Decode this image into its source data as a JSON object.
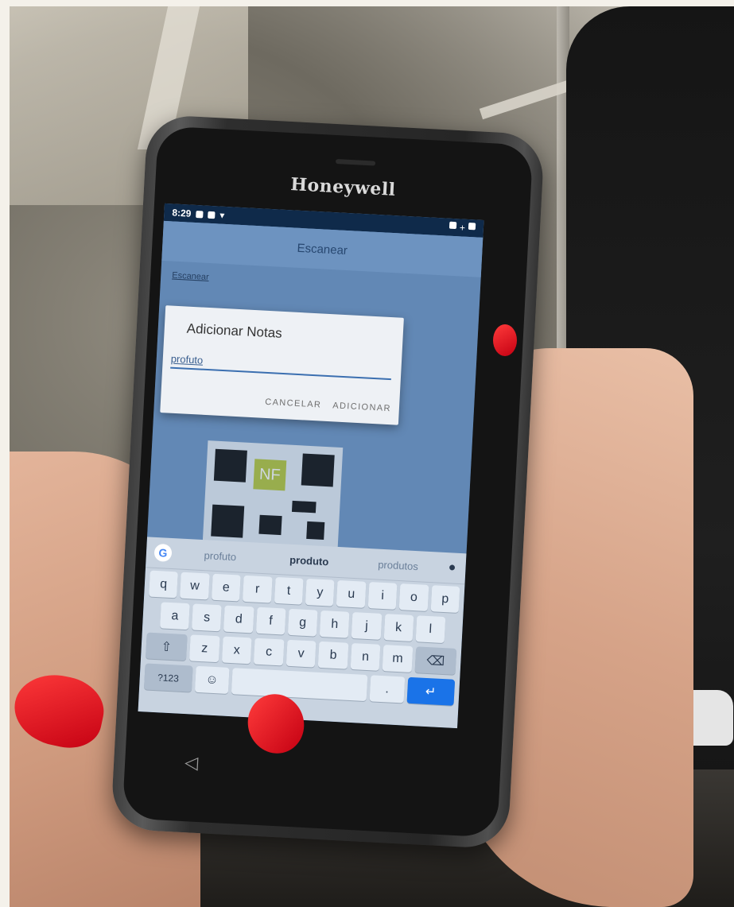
{
  "device": {
    "brand": "Honeywell"
  },
  "status_bar": {
    "time": "8:29"
  },
  "app": {
    "title": "Escanear",
    "content_label": "Escanear"
  },
  "dialog": {
    "title": "Adicionar Notas",
    "input_value": "profuto",
    "cancel_label": "CANCELAR",
    "confirm_label": "ADICIONAR"
  },
  "qr": {
    "overlay_text": "NF"
  },
  "keyboard": {
    "suggestions": [
      "profuto",
      "produto",
      "produtos"
    ],
    "row1": [
      "q",
      "w",
      "e",
      "r",
      "t",
      "y",
      "u",
      "i",
      "o",
      "p"
    ],
    "row2": [
      "a",
      "s",
      "d",
      "f",
      "g",
      "h",
      "j",
      "k",
      "l"
    ],
    "row3": [
      "z",
      "x",
      "c",
      "v",
      "b",
      "n",
      "m"
    ],
    "symbols_label": "?123",
    "icons": {
      "google": "google-icon",
      "mic": "mic-icon",
      "shift": "shift-icon",
      "backspace": "backspace-icon",
      "emoji": "emoji-icon",
      "enter": "enter-icon"
    }
  }
}
